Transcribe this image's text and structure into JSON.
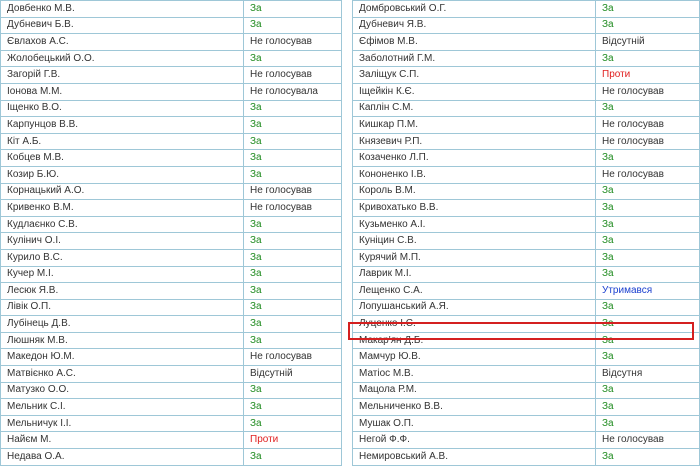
{
  "highlight_color": "#d42020",
  "vote_colors": {
    "За": "#1e8a1e",
    "Проти": "#e02020",
    "Утримався": "#1a3fcf",
    "default": "#333333"
  },
  "left_table": {
    "rows": [
      {
        "name": "Довбенко М.В.",
        "vote": "За"
      },
      {
        "name": "Дубневич Б.В.",
        "vote": "За"
      },
      {
        "name": "Євлахов А.С.",
        "vote": "Не голосував"
      },
      {
        "name": "Жолобецький О.О.",
        "vote": "За"
      },
      {
        "name": "Загорій Г.В.",
        "vote": "Не голосував"
      },
      {
        "name": "Іонова М.М.",
        "vote": "Не голосувала"
      },
      {
        "name": "Іщенко В.О.",
        "vote": "За"
      },
      {
        "name": "Карпунцов В.В.",
        "vote": "За"
      },
      {
        "name": "Кіт А.Б.",
        "vote": "За"
      },
      {
        "name": "Кобцев М.В.",
        "vote": "За"
      },
      {
        "name": "Козир Б.Ю.",
        "vote": "За"
      },
      {
        "name": "Корнацький А.О.",
        "vote": "Не голосував"
      },
      {
        "name": "Кривенко В.М.",
        "vote": "Не голосував"
      },
      {
        "name": "Кудлаєнко С.В.",
        "vote": "За"
      },
      {
        "name": "Кулінич О.І.",
        "vote": "За"
      },
      {
        "name": "Курило В.С.",
        "vote": "За"
      },
      {
        "name": "Кучер М.І.",
        "vote": "За"
      },
      {
        "name": "Лесюк Я.В.",
        "vote": "За"
      },
      {
        "name": "Лівік О.П.",
        "vote": "За"
      },
      {
        "name": "Лубінець Д.В.",
        "vote": "За"
      },
      {
        "name": "Люшняк М.В.",
        "vote": "За"
      },
      {
        "name": "Македон Ю.М.",
        "vote": "Не голосував"
      },
      {
        "name": "Матвієнко А.С.",
        "vote": "Відсутній"
      },
      {
        "name": "Матузко О.О.",
        "vote": "За"
      },
      {
        "name": "Мельник С.І.",
        "vote": "За"
      },
      {
        "name": "Мельничук І.І.",
        "vote": "За"
      },
      {
        "name": "Найєм М.",
        "vote": "Проти"
      },
      {
        "name": "Недава О.А.",
        "vote": "За"
      }
    ]
  },
  "right_table": {
    "rows": [
      {
        "name": "Домбровський О.Г.",
        "vote": "За"
      },
      {
        "name": "Дубневич Я.В.",
        "vote": "За"
      },
      {
        "name": "Єфімов М.В.",
        "vote": "Відсутній"
      },
      {
        "name": "Заболотний Г.М.",
        "vote": "За"
      },
      {
        "name": "Заліщук С.П.",
        "vote": "Проти"
      },
      {
        "name": "Іщейкін К.Є.",
        "vote": "Не голосував"
      },
      {
        "name": "Каплін С.М.",
        "vote": "За"
      },
      {
        "name": "Кишкар П.М.",
        "vote": "Не голосував"
      },
      {
        "name": "Князевич Р.П.",
        "vote": "Не голосував"
      },
      {
        "name": "Козаченко Л.П.",
        "vote": "За"
      },
      {
        "name": "Кононенко І.В.",
        "vote": "Не голосував"
      },
      {
        "name": "Король В.М.",
        "vote": "За"
      },
      {
        "name": "Кривохатько В.В.",
        "vote": "За"
      },
      {
        "name": "Кузьменко А.І.",
        "vote": "За"
      },
      {
        "name": "Куніцин С.В.",
        "vote": "За"
      },
      {
        "name": "Курячий М.П.",
        "vote": "За"
      },
      {
        "name": "Лаврик М.І.",
        "vote": "За"
      },
      {
        "name": "Лещенко С.А.",
        "vote": "Утримався"
      },
      {
        "name": "Лопушанський А.Я.",
        "vote": "За"
      },
      {
        "name": "Луценко І.С.",
        "vote": "За"
      },
      {
        "name": "Макар'ян Д.Б.",
        "vote": "За",
        "highlighted": true
      },
      {
        "name": "Мамчур Ю.В.",
        "vote": "За"
      },
      {
        "name": "Матіос М.В.",
        "vote": "Відсутня"
      },
      {
        "name": "Мацола Р.М.",
        "vote": "За"
      },
      {
        "name": "Мельниченко В.В.",
        "vote": "За"
      },
      {
        "name": "Мушак О.П.",
        "vote": "За"
      },
      {
        "name": "Негой Ф.Ф.",
        "vote": "Не голосував"
      },
      {
        "name": "Немировський А.В.",
        "vote": "За"
      }
    ]
  }
}
